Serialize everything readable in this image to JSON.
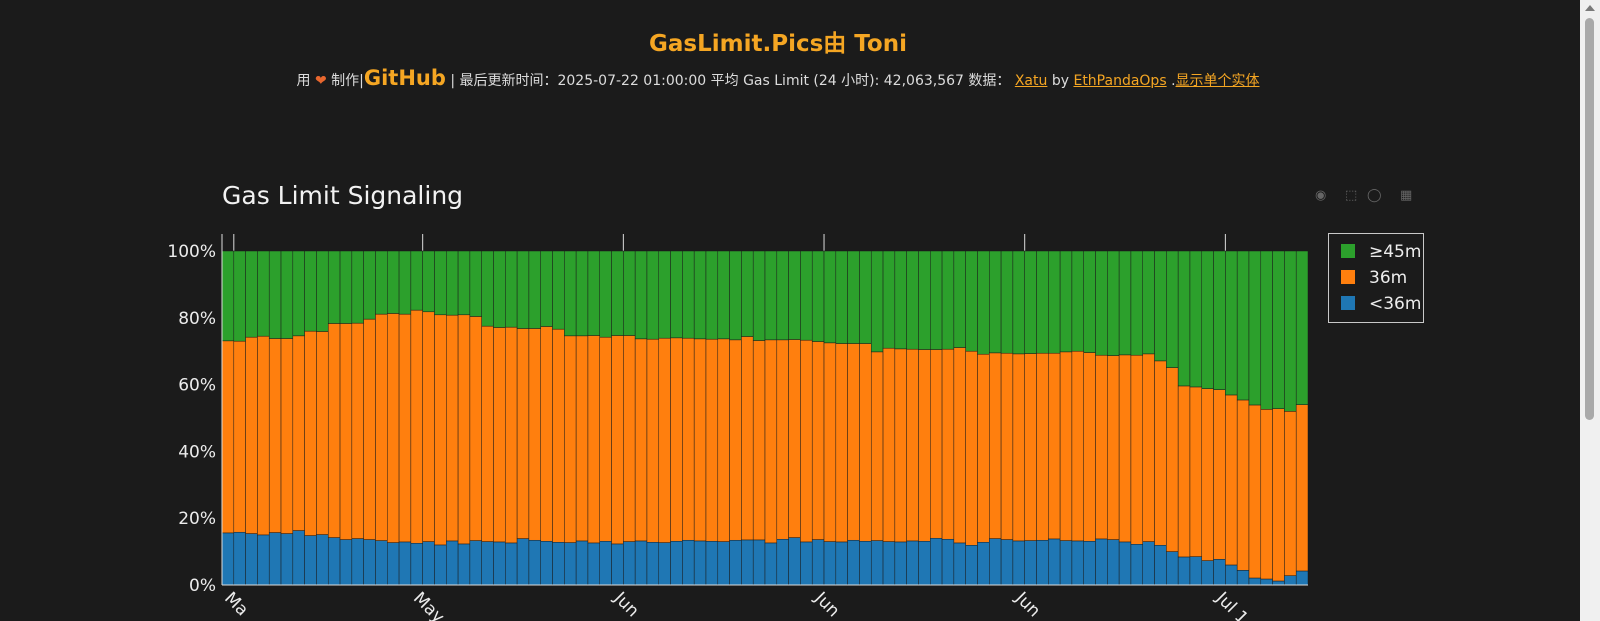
{
  "header": {
    "title": "GasLimit.Pics由 Toni",
    "made_with_prefix": "用",
    "made_with_suffix": "制作|",
    "github": "GitHub",
    "updated_label": "| 最后更新时间：2025-07-22 01:00:00 平均 Gas Limit (24 小时): 42,063,567 数据：",
    "xatu": "Xatu",
    "by": "by",
    "pandaops": "EthPandaOps",
    "dot": ".",
    "single_entity": "显示单个实体"
  },
  "icons": [
    "camera-icon",
    "box-select-icon",
    "lasso-icon",
    "plotly-logo-icon",
    "heart-icon"
  ],
  "colors": {
    "green": "#2ca02c",
    "orange": "#ff7f0e",
    "blue": "#1f77b4",
    "background": "#1b1b1b",
    "accent": "#f5a623"
  },
  "chart_data": {
    "type": "bar",
    "stacked": true,
    "title": "Gas Limit Signaling",
    "ylim": [
      0,
      100
    ],
    "y_ticks": [
      "0%",
      "20%",
      "40%",
      "60%",
      "80%",
      "100%"
    ],
    "x_tick_labels": [
      "Ma",
      "May",
      "Jun",
      "Jun",
      "Jun",
      "Jul 1"
    ],
    "legend": [
      "≥45m",
      "36m",
      "<36m"
    ],
    "legend_position": "right",
    "series": [
      {
        "name": "<36m",
        "values": [
          15.6,
          15.8,
          15.4,
          15.0,
          15.7,
          15.4,
          16.3,
          14.8,
          15.1,
          14.2,
          13.6,
          13.9,
          13.6,
          13.3,
          12.7,
          12.9,
          12.5,
          13.0,
          12.0,
          13.2,
          12.3,
          13.3,
          13.0,
          12.9,
          12.6,
          13.9,
          13.4,
          13.1,
          12.8,
          12.7,
          13.2,
          12.6,
          13.1,
          12.3,
          13.0,
          13.2,
          12.8,
          12.7,
          13.1,
          13.4,
          13.2,
          13.1,
          13.0,
          13.4,
          13.5,
          13.5,
          12.6,
          13.7,
          14.2,
          12.9,
          13.6,
          13.0,
          12.9,
          13.4,
          13.1,
          13.3,
          13.0,
          12.9,
          13.2,
          13.1,
          14.0,
          13.7,
          12.6,
          11.9,
          12.8,
          13.9,
          13.6,
          13.2,
          13.3,
          13.4,
          13.8,
          13.3,
          13.2,
          13.1,
          13.8,
          13.6,
          12.9,
          12.2,
          13.0,
          11.9,
          10.0,
          8.4,
          8.5,
          7.3,
          7.7,
          6.0,
          4.4,
          2.1,
          1.8,
          1.2,
          2.8,
          4.2
        ]
      },
      {
        "name": "36m",
        "values": [
          57.5,
          57.2,
          58.8,
          59.5,
          58.1,
          58.4,
          58.3,
          61.2,
          60.8,
          64.1,
          64.7,
          64.5,
          66.0,
          67.8,
          68.6,
          68.2,
          69.8,
          68.8,
          68.9,
          67.6,
          68.6,
          67.1,
          64.5,
          64.2,
          64.6,
          62.9,
          63.4,
          64.3,
          63.8,
          61.9,
          61.4,
          62.1,
          61.1,
          62.4,
          61.7,
          60.5,
          60.8,
          61.2,
          60.9,
          60.5,
          60.5,
          60.5,
          60.7,
          60.0,
          60.9,
          59.7,
          60.8,
          59.7,
          59.3,
          60.4,
          59.3,
          59.5,
          59.4,
          58.9,
          59.2,
          56.5,
          57.9,
          57.8,
          57.4,
          57.4,
          56.5,
          56.9,
          58.5,
          58.1,
          56.3,
          55.6,
          55.8,
          56.0,
          56.0,
          56.0,
          55.6,
          56.5,
          56.8,
          56.5,
          55.0,
          55.1,
          56.0,
          56.6,
          56.2,
          55.2,
          55.1,
          51.2,
          50.8,
          51.5,
          50.8,
          50.9,
          51.0,
          51.8,
          50.8,
          51.6,
          49.2,
          49.8
        ]
      },
      {
        "name": "≥45m",
        "values": [
          26.9,
          27.0,
          25.8,
          25.5,
          26.2,
          26.2,
          25.4,
          24.0,
          24.1,
          21.7,
          21.7,
          21.6,
          20.4,
          18.9,
          18.7,
          18.9,
          17.7,
          18.2,
          19.1,
          19.2,
          19.1,
          19.6,
          22.5,
          22.9,
          22.8,
          23.2,
          23.2,
          22.6,
          23.4,
          25.4,
          25.4,
          25.3,
          25.8,
          25.3,
          25.3,
          26.3,
          26.4,
          26.1,
          26.0,
          26.1,
          26.3,
          26.4,
          26.3,
          26.6,
          25.6,
          26.8,
          26.6,
          26.6,
          26.5,
          26.7,
          27.1,
          27.5,
          27.7,
          27.7,
          27.7,
          30.2,
          29.1,
          29.3,
          29.4,
          29.5,
          29.5,
          29.4,
          28.9,
          30.0,
          30.9,
          30.5,
          30.6,
          30.8,
          30.7,
          30.6,
          30.6,
          30.2,
          30.0,
          30.4,
          31.2,
          31.3,
          31.1,
          31.2,
          30.8,
          32.9,
          34.9,
          40.4,
          40.7,
          41.2,
          41.5,
          43.1,
          44.6,
          46.1,
          47.4,
          47.2,
          48.0,
          46.0
        ]
      }
    ]
  }
}
